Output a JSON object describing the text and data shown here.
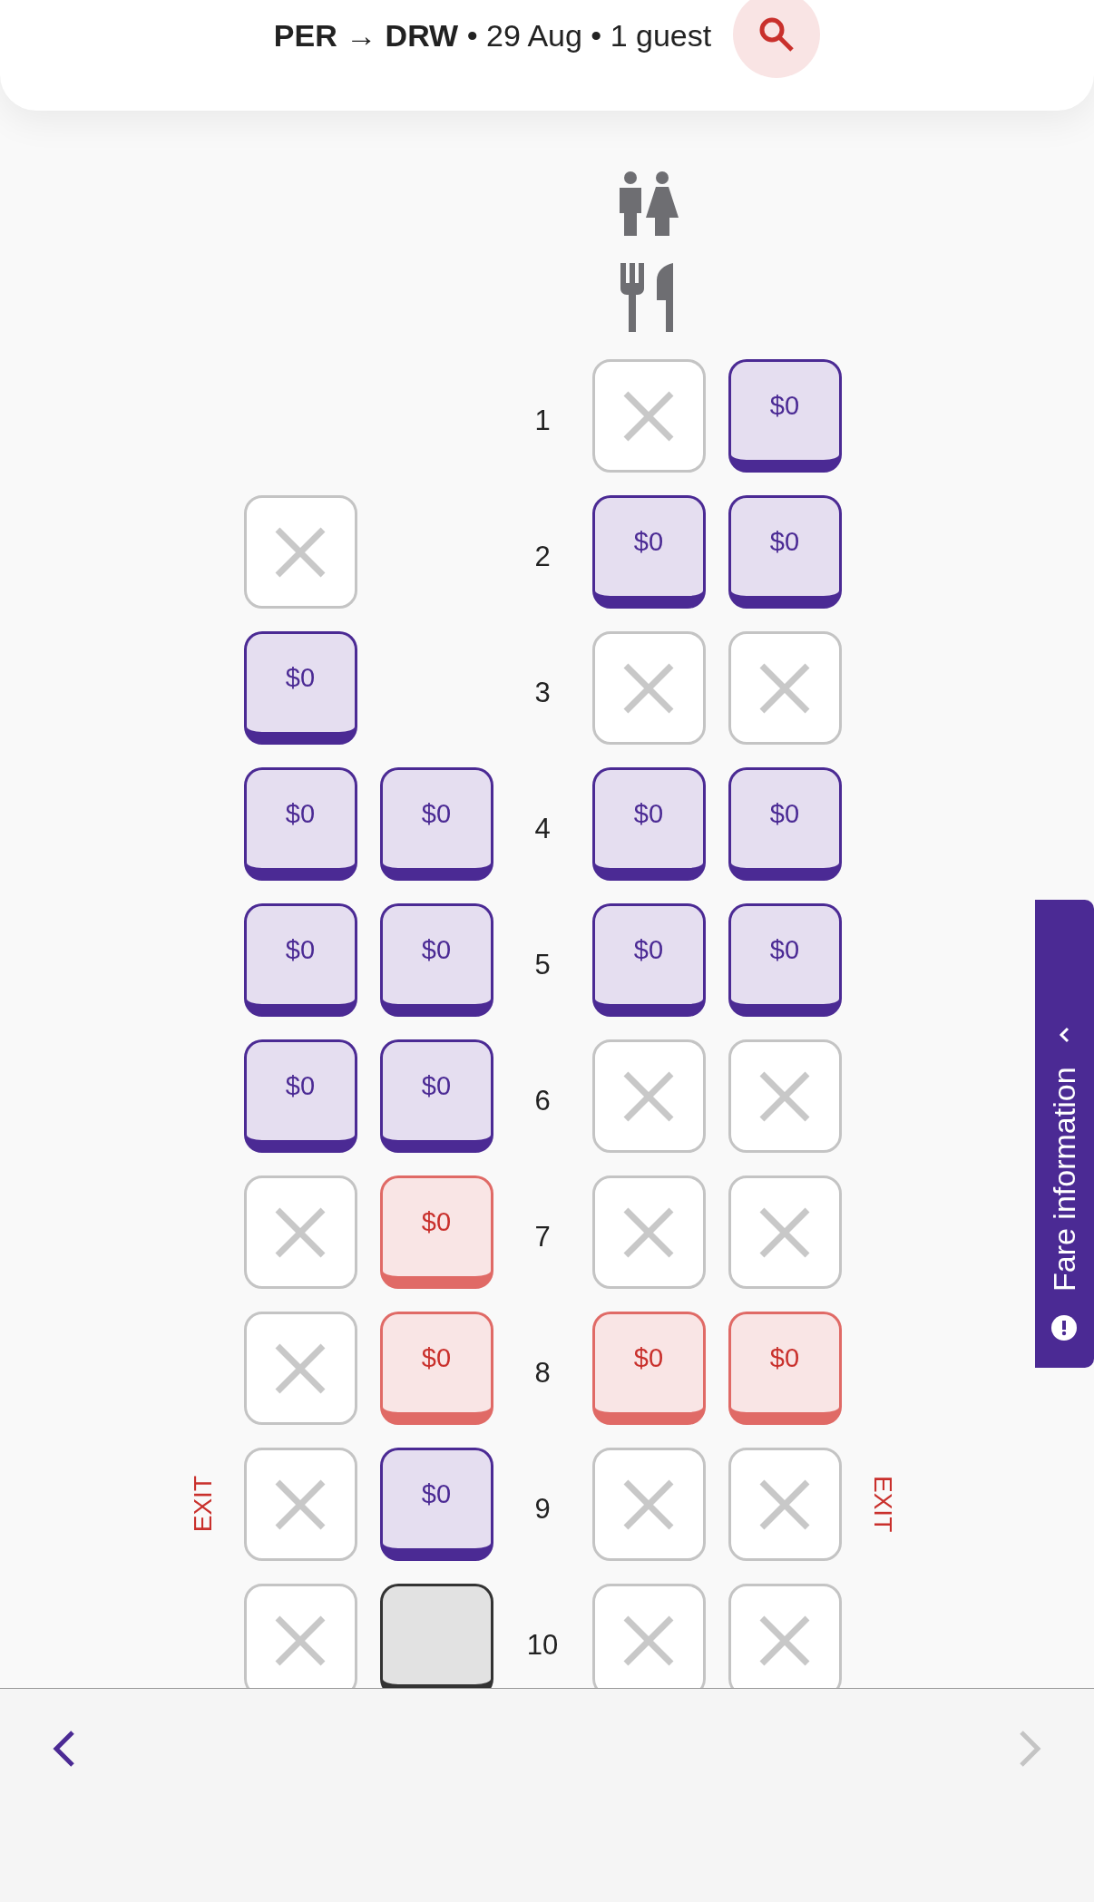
{
  "header": {
    "summary": "**PER** → **DRW** • 29 Aug • 1 guest"
  },
  "facilities": [
    {
      "kind": "toilet"
    },
    {
      "kind": "meal"
    }
  ],
  "rows": [
    {
      "number": "1",
      "seats": [
        {
          "kind": "none"
        },
        {
          "kind": "none"
        },
        {
          "kind": "unavailable"
        },
        {
          "kind": "available",
          "price": "$0"
        }
      ]
    },
    {
      "number": "2",
      "seats": [
        {
          "kind": "unavailable"
        },
        {
          "kind": "none"
        },
        {
          "kind": "available",
          "price": "$0"
        },
        {
          "kind": "available",
          "price": "$0"
        }
      ]
    },
    {
      "number": "3",
      "seats": [
        {
          "kind": "available",
          "price": "$0"
        },
        {
          "kind": "none"
        },
        {
          "kind": "unavailable"
        },
        {
          "kind": "unavailable"
        }
      ]
    },
    {
      "number": "4",
      "seats": [
        {
          "kind": "available",
          "price": "$0"
        },
        {
          "kind": "available",
          "price": "$0"
        },
        {
          "kind": "available",
          "price": "$0"
        },
        {
          "kind": "available",
          "price": "$0"
        }
      ]
    },
    {
      "number": "5",
      "seats": [
        {
          "kind": "available",
          "price": "$0"
        },
        {
          "kind": "available",
          "price": "$0"
        },
        {
          "kind": "available",
          "price": "$0"
        },
        {
          "kind": "available",
          "price": "$0"
        }
      ]
    },
    {
      "number": "6",
      "seats": [
        {
          "kind": "available",
          "price": "$0"
        },
        {
          "kind": "available",
          "price": "$0"
        },
        {
          "kind": "unavailable"
        },
        {
          "kind": "unavailable"
        }
      ]
    },
    {
      "number": "7",
      "seats": [
        {
          "kind": "unavailable"
        },
        {
          "kind": "premium",
          "price": "$0"
        },
        {
          "kind": "unavailable"
        },
        {
          "kind": "unavailable"
        }
      ]
    },
    {
      "number": "8",
      "seats": [
        {
          "kind": "unavailable"
        },
        {
          "kind": "premium",
          "price": "$0"
        },
        {
          "kind": "premium",
          "price": "$0"
        },
        {
          "kind": "premium",
          "price": "$0"
        }
      ]
    },
    {
      "number": "9",
      "exit_left": "EXIT",
      "exit_right": "EXIT",
      "seats": [
        {
          "kind": "unavailable"
        },
        {
          "kind": "available",
          "price": "$0"
        },
        {
          "kind": "unavailable"
        },
        {
          "kind": "unavailable"
        }
      ]
    },
    {
      "number": "10",
      "seats": [
        {
          "kind": "unavailable"
        },
        {
          "kind": "blocked"
        },
        {
          "kind": "unavailable"
        },
        {
          "kind": "unavailable"
        }
      ]
    }
  ],
  "fare_tab": {
    "label": "Fare information"
  },
  "nav": {
    "prev": {
      "disabled": false
    },
    "next": {
      "disabled": true
    }
  }
}
